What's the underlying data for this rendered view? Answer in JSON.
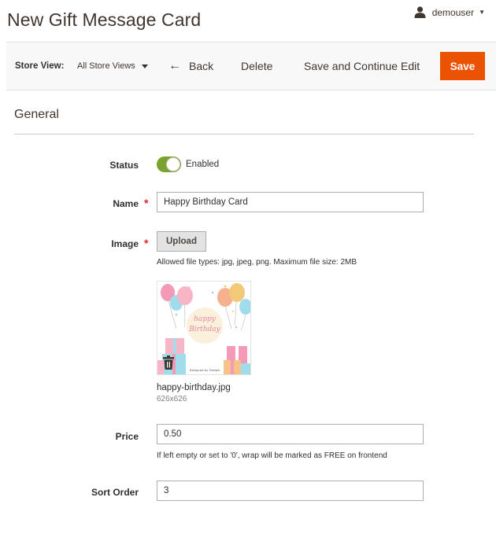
{
  "header": {
    "title": "New Gift Message Card",
    "user": {
      "name": "demouser",
      "icon": "user-icon"
    }
  },
  "toolbar": {
    "store_view_label": "Store View:",
    "store_view_value": "All Store Views",
    "back_label": "Back",
    "delete_label": "Delete",
    "save_continue_label": "Save and Continue Edit",
    "save_label": "Save"
  },
  "section": {
    "title": "General"
  },
  "form": {
    "status": {
      "label": "Status",
      "value_text": "Enabled",
      "enabled": true
    },
    "name": {
      "label": "Name",
      "value": "Happy Birthday Card",
      "required": true
    },
    "image": {
      "label": "Image",
      "required": true,
      "upload_label": "Upload",
      "allowed_note": "Allowed file types: jpg, jpeg, png. Maximum file size: 2MB",
      "file_name": "happy-birthday.jpg",
      "dimensions": "626x626",
      "preview_text": "happy Birthday",
      "credit_text": "Designed by Freepik"
    },
    "price": {
      "label": "Price",
      "value": "0.50",
      "note": "If left empty or set to '0', wrap will be marked as FREE on frontend"
    },
    "sort_order": {
      "label": "Sort Order",
      "value": "3"
    }
  },
  "colors": {
    "accent": "#eb5202",
    "toggle_on": "#79a22e",
    "required": "#e22626"
  }
}
